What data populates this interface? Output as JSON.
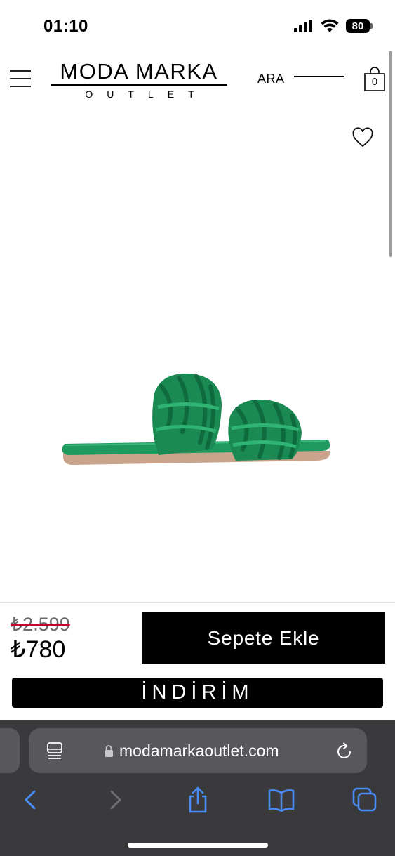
{
  "status_bar": {
    "time": "01:10",
    "battery": "80"
  },
  "header": {
    "logo_main": "MODA MARKA",
    "logo_sub": "OUTLET",
    "search_label": "ARA",
    "cart_count": "0"
  },
  "product": {
    "image_alt": "green braided flat slide sandal",
    "color": "#1f9a5f",
    "old_price": "₺2.599",
    "new_price": "₺780",
    "add_to_cart_label": "Sepete Ekle",
    "sale_label": "İNDİRİM"
  },
  "browser": {
    "url": "modamarkaoutlet.com",
    "accent": "#4a8cf7"
  },
  "icons": [
    "menu-icon",
    "shopping-bag-icon",
    "heart-icon",
    "reader-icon",
    "lock-icon",
    "reload-icon",
    "back-icon",
    "forward-icon",
    "share-icon",
    "bookmarks-icon",
    "tabs-icon"
  ]
}
